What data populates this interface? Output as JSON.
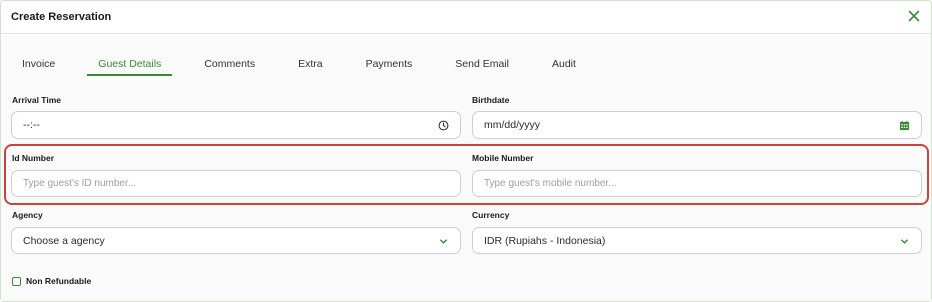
{
  "dialog": {
    "title": "Create Reservation",
    "accent_color": "#3a8a3a",
    "highlight_color": "#c9443a"
  },
  "tabs": [
    {
      "label": "Invoice",
      "active": false
    },
    {
      "label": "Guest Details",
      "active": true
    },
    {
      "label": "Comments",
      "active": false
    },
    {
      "label": "Extra",
      "active": false
    },
    {
      "label": "Payments",
      "active": false
    },
    {
      "label": "Send Email",
      "active": false
    },
    {
      "label": "Audit",
      "active": false
    }
  ],
  "form": {
    "arrival_time": {
      "label": "Arrival Time",
      "value": "--:--",
      "icon": "clock-icon"
    },
    "birthdate": {
      "label": "Birthdate",
      "value": "mm/dd/yyyy",
      "icon": "calendar-icon"
    },
    "id_number": {
      "label": "Id Number",
      "placeholder": "Type guest's ID number..."
    },
    "mobile_number": {
      "label": "Mobile Number",
      "placeholder": "Type guest's mobile number..."
    },
    "agency": {
      "label": "Agency",
      "value": "Choose a agency",
      "icon": "chevron-down-icon"
    },
    "currency": {
      "label": "Currency",
      "value": "IDR (Rupiahs - Indonesia)",
      "icon": "chevron-down-icon"
    },
    "non_refundable": {
      "label": "Non Refundable",
      "checked": false
    }
  }
}
